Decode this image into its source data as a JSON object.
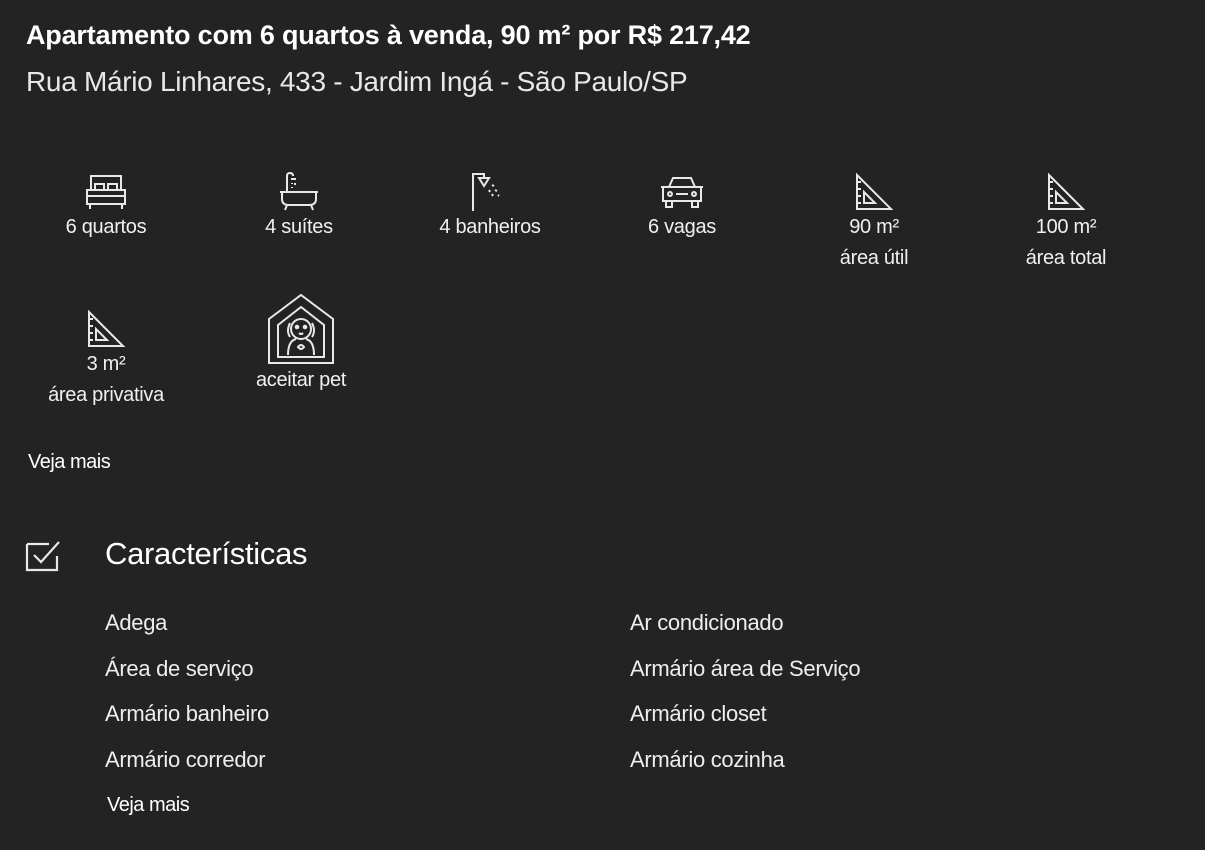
{
  "listing": {
    "title": "Apartamento com 6 quartos à venda, 90 m² por R$ 217,42",
    "address": "Rua Mário Linhares, 433 - Jardim Ingá - São Paulo/SP"
  },
  "features": [
    {
      "icon": "bed-icon",
      "label": "6 quartos",
      "sublabel": ""
    },
    {
      "icon": "bathtub-icon",
      "label": "4 suítes",
      "sublabel": ""
    },
    {
      "icon": "shower-icon",
      "label": "4 banheiros",
      "sublabel": ""
    },
    {
      "icon": "car-icon",
      "label": "6 vagas",
      "sublabel": ""
    },
    {
      "icon": "set-square-icon",
      "label": "90 m²",
      "sublabel": "área útil"
    },
    {
      "icon": "set-square-icon",
      "label": "100 m²",
      "sublabel": "área total"
    },
    {
      "icon": "set-square-icon",
      "label": "3 m²",
      "sublabel": "área privativa"
    },
    {
      "icon": "pet-house-icon",
      "label": "aceitar pet",
      "sublabel": ""
    }
  ],
  "features_see_more": "Veja mais",
  "characteristics": {
    "icon": "checkbox-icon",
    "title": "Características",
    "items": [
      "Adega",
      "Ar condicionado",
      "Área de serviço",
      "Armário área de Serviço",
      "Armário banheiro",
      "Armário closet",
      "Armário corredor",
      "Armário cozinha"
    ],
    "see_more": "Veja mais"
  }
}
